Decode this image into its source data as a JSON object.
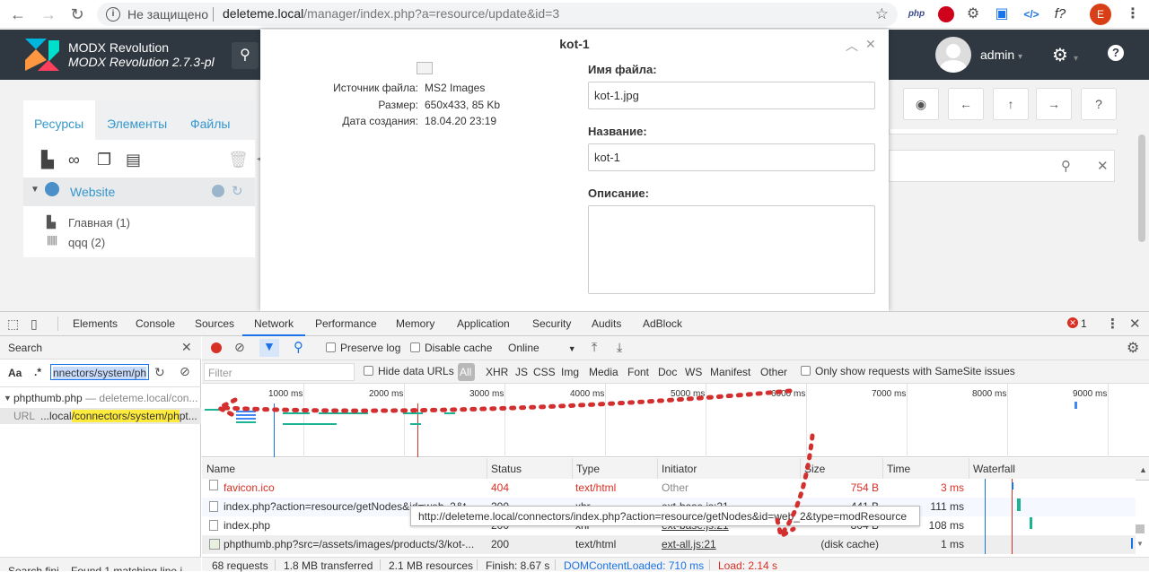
{
  "browser": {
    "security": "Не защищено",
    "url_host": "deleteme.local",
    "url_path": "/manager/index.php?a=resource/update&id=3",
    "profile_letter": "E",
    "ext_php": "php",
    "ext_fn": "f?",
    "ext_code": "</>"
  },
  "header": {
    "brand": "MODX Revolution",
    "version": "MODX Revolution 2.7.3-pl",
    "user": "admin"
  },
  "leftpanel": {
    "tabs": [
      "Ресурсы",
      "Элементы",
      "Файлы"
    ],
    "root": "Website",
    "items": [
      "Главная (1)",
      "qqq (2)"
    ]
  },
  "modal": {
    "title": "kot-1",
    "meta": [
      {
        "label": "Источник файла:",
        "value": "MS2 Images"
      },
      {
        "label": "Размер:",
        "value": "650x433, 85 Kb"
      },
      {
        "label": "Дата создания:",
        "value": "18.04.20 23:19"
      }
    ],
    "filename_label": "Имя файла:",
    "filename_value": "kot-1.jpg",
    "name_label": "Название:",
    "name_value": "kot-1",
    "desc_label": "Описание:"
  },
  "devtools": {
    "tabs": [
      "Elements",
      "Console",
      "Sources",
      "Network",
      "Performance",
      "Memory",
      "Application",
      "Security",
      "Audits",
      "AdBlock"
    ],
    "error_count": "1",
    "search_label": "Search",
    "search_aa": "Aa",
    "search_regex": ".*",
    "search_value": "nnectors/system/ph",
    "result_file": "phpthumb.php",
    "result_host": "— deleteme.local/con...",
    "result_url_label": "URL",
    "result_url_prefix": "...local",
    "result_url_match": "/connectors/system/ph",
    "result_url_suffix": "pt...",
    "search_status": "Search fini...   Found 1 matching line i...",
    "preserve_log": "Preserve log",
    "disable_cache": "Disable cache",
    "throttle": "Online",
    "filter_placeholder": "Filter",
    "hide_data_urls": "Hide data URLs",
    "filter_types": [
      "All",
      "XHR",
      "JS",
      "CSS",
      "Img",
      "Media",
      "Font",
      "Doc",
      "WS",
      "Manifest",
      "Other"
    ],
    "samesite": "Only show requests with SameSite issues",
    "ticks": [
      "1000 ms",
      "2000 ms",
      "3000 ms",
      "4000 ms",
      "5000 ms",
      "6000 ms",
      "7000 ms",
      "8000 ms",
      "9000 ms"
    ],
    "columns": [
      "Name",
      "Status",
      "Type",
      "Initiator",
      "Size",
      "Time",
      "Waterfall"
    ],
    "rows": [
      {
        "name": "favicon.ico",
        "status": "404",
        "type": "text/html",
        "initiator": "Other",
        "size": "754 B",
        "time": "3 ms",
        "error": true
      },
      {
        "name": "index.php?action=resource/getNodes&id=web_2&t...",
        "status": "200",
        "type": "xhr",
        "initiator": "ext-base.js:21",
        "size": "441 B",
        "time": "111 ms",
        "error": false
      },
      {
        "name": "index.php",
        "status": "200",
        "type": "xhr",
        "initiator": "ext-base.js:21",
        "size": "804 B",
        "time": "108 ms",
        "error": false
      },
      {
        "name": "phpthumb.php?src=/assets/images/products/3/kot-...",
        "status": "200",
        "type": "text/html",
        "initiator": "ext-all.js:21",
        "size": "(disk cache)",
        "time": "1 ms",
        "error": false
      }
    ],
    "tooltip": "http://deleteme.local/connectors/index.php?action=resource/getNodes&id=web_2&type=modResource",
    "status": {
      "requests": "68 requests",
      "transferred": "1.8 MB transferred",
      "resources": "2.1 MB resources",
      "finish": "Finish: 8.67 s",
      "dcl": "DOMContentLoaded: 710 ms",
      "load": "Load: 2.14 s"
    }
  },
  "colors": {
    "header_bg": "#2f3840",
    "link_blue": "#3697cd",
    "error_red": "#d93025",
    "annotation_red": "#d32f2f"
  }
}
